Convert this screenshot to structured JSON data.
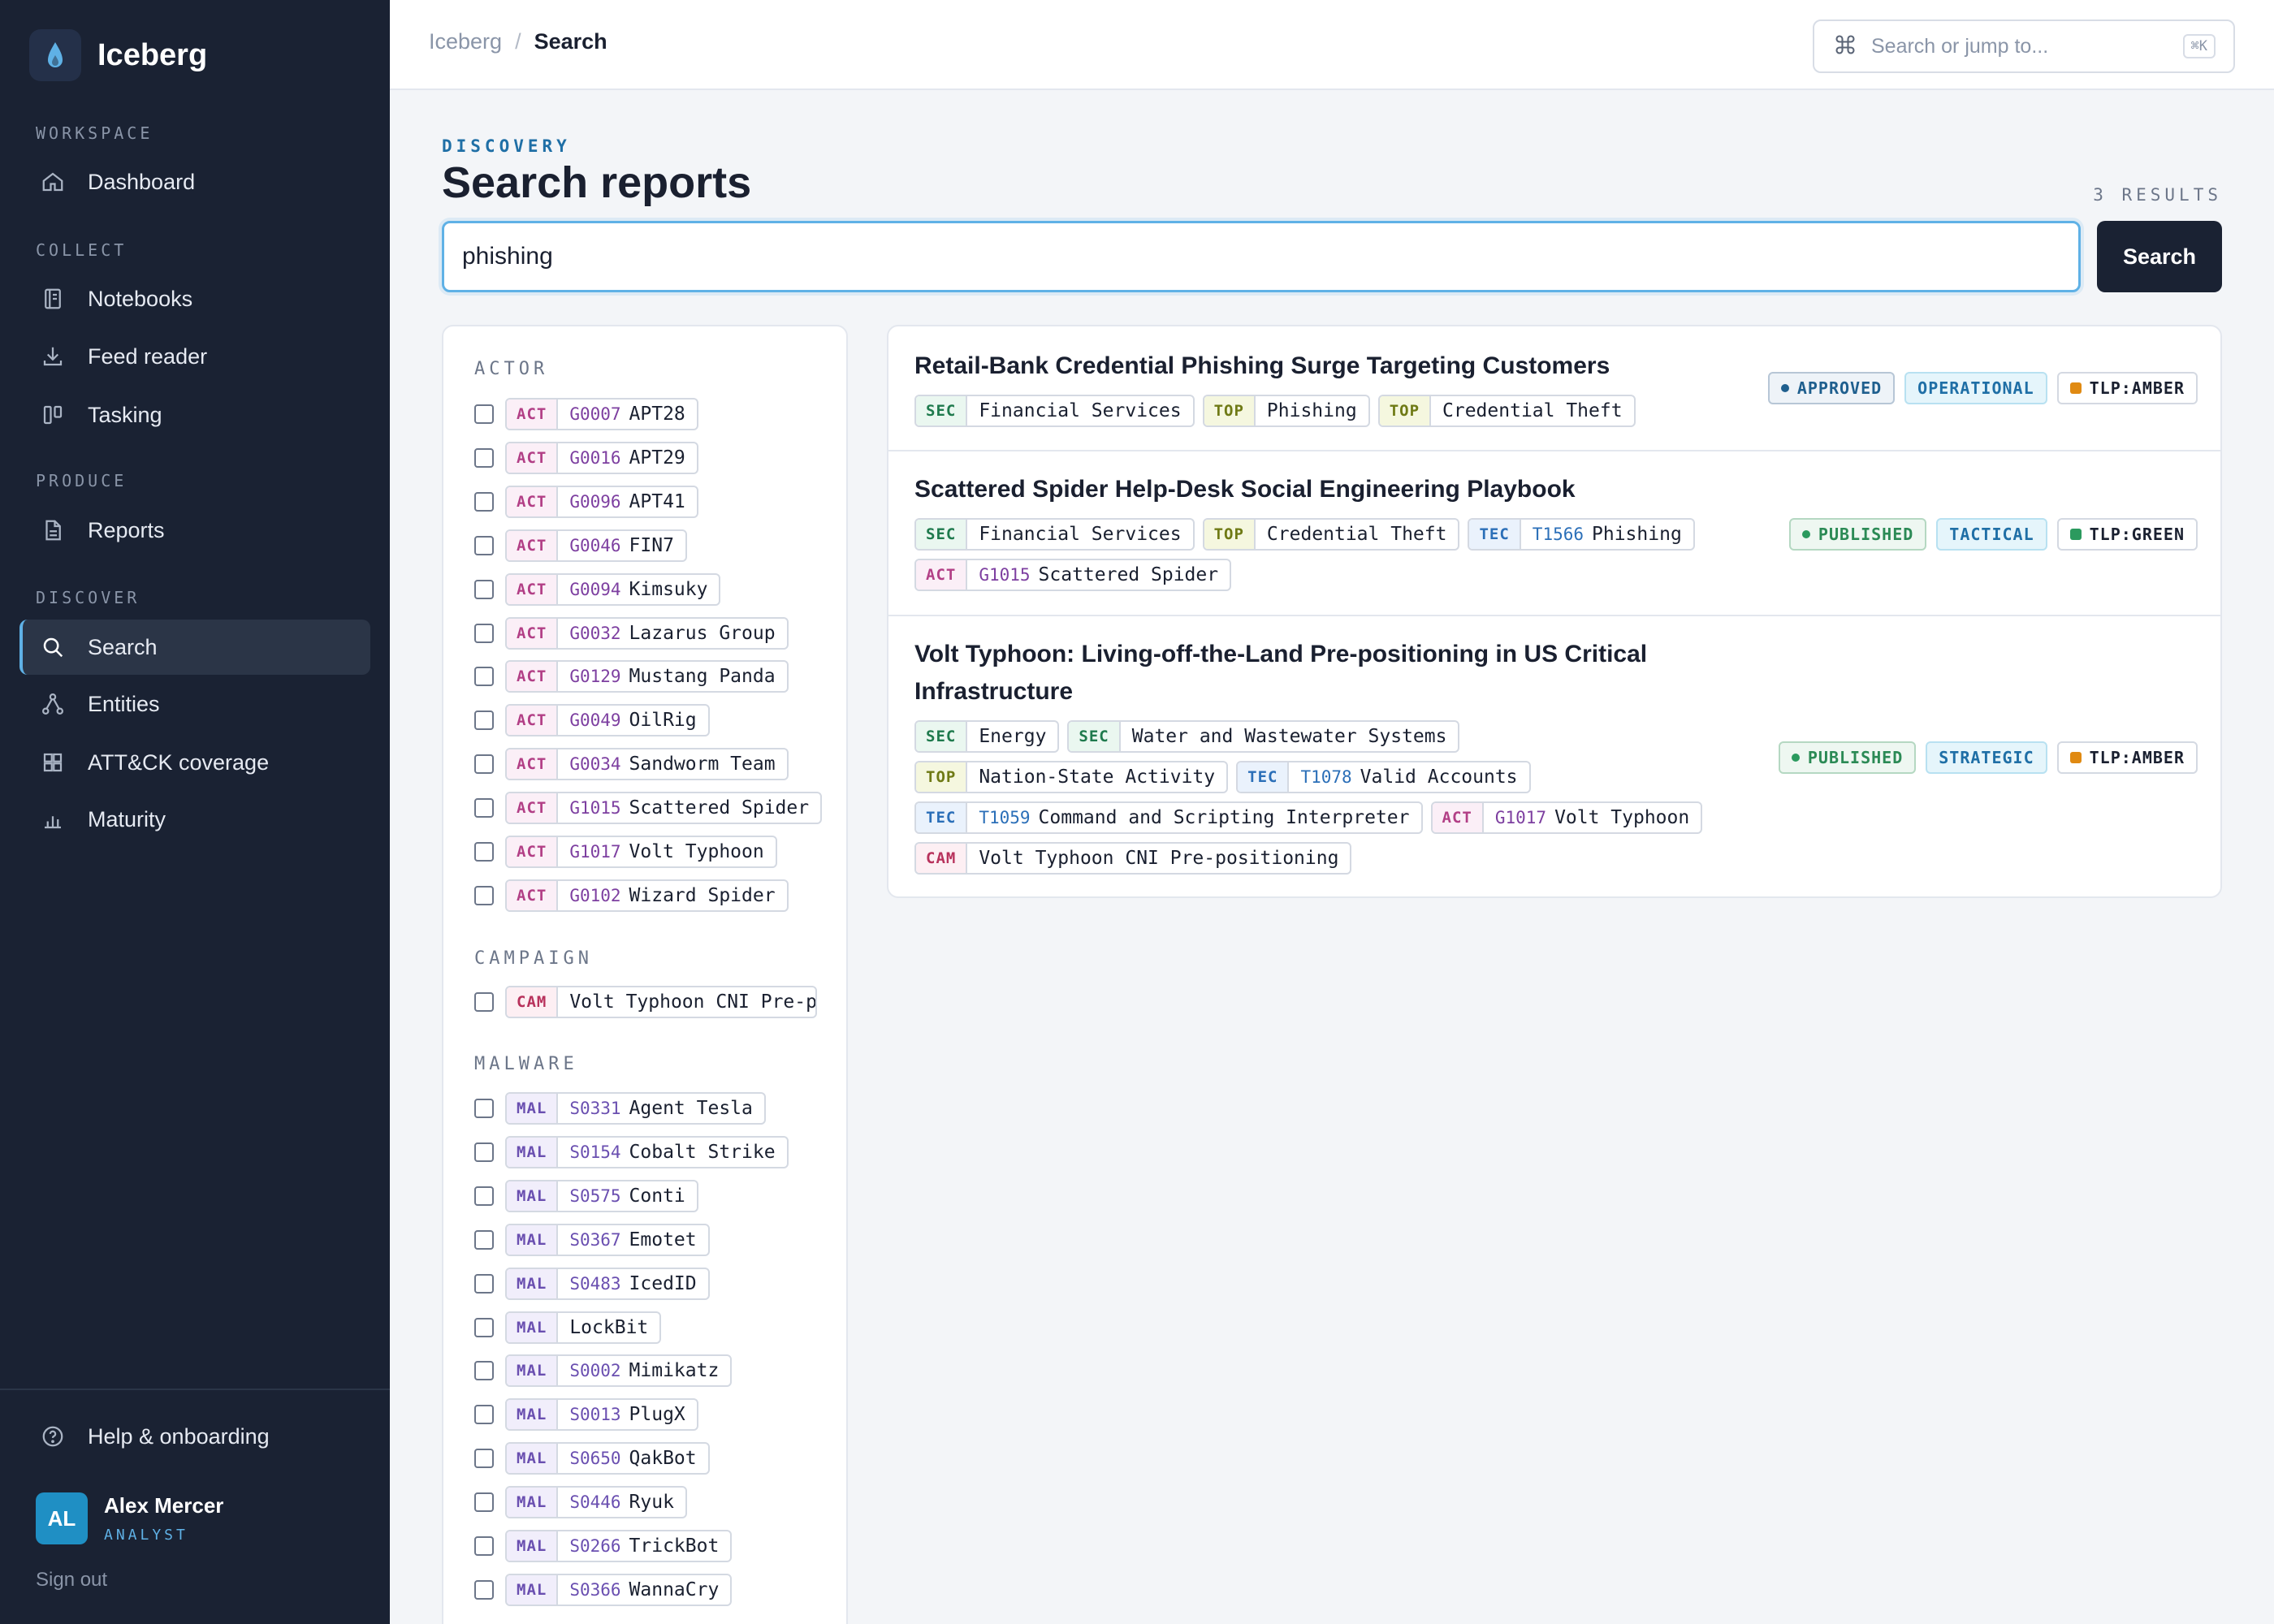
{
  "app": {
    "name": "Iceberg"
  },
  "sidebar": {
    "sections": [
      {
        "label": "WORKSPACE",
        "items": [
          {
            "label": "Dashboard",
            "icon": "home-icon"
          }
        ]
      },
      {
        "label": "COLLECT",
        "items": [
          {
            "label": "Notebooks",
            "icon": "notebook-icon"
          },
          {
            "label": "Feed reader",
            "icon": "download-icon"
          },
          {
            "label": "Tasking",
            "icon": "kanban-icon"
          }
        ]
      },
      {
        "label": "PRODUCE",
        "items": [
          {
            "label": "Reports",
            "icon": "document-icon"
          }
        ]
      },
      {
        "label": "DISCOVER",
        "items": [
          {
            "label": "Search",
            "icon": "search-icon",
            "active": true
          },
          {
            "label": "Entities",
            "icon": "graph-icon"
          },
          {
            "label": "ATT&CK coverage",
            "icon": "grid-icon"
          },
          {
            "label": "Maturity",
            "icon": "bar-chart-icon"
          }
        ]
      }
    ],
    "help_label": "Help & onboarding",
    "user": {
      "initials": "AL",
      "name": "Alex Mercer",
      "role": "ANALYST"
    },
    "signout_label": "Sign out"
  },
  "topbar": {
    "breadcrumb_root": "Iceberg",
    "breadcrumb_sep": "/",
    "breadcrumb_current": "Search",
    "jump_placeholder": "Search or jump to...",
    "jump_shortcut": "⌘K"
  },
  "main": {
    "eyebrow": "DISCOVERY",
    "title": "Search reports",
    "result_count": "3 RESULTS",
    "query": "phishing",
    "search_button": "Search"
  },
  "facets": {
    "actor": {
      "title": "ACTOR",
      "items": [
        {
          "type": "ACT",
          "code": "G0007",
          "name": "APT28"
        },
        {
          "type": "ACT",
          "code": "G0016",
          "name": "APT29"
        },
        {
          "type": "ACT",
          "code": "G0096",
          "name": "APT41"
        },
        {
          "type": "ACT",
          "code": "G0046",
          "name": "FIN7"
        },
        {
          "type": "ACT",
          "code": "G0094",
          "name": "Kimsuky"
        },
        {
          "type": "ACT",
          "code": "G0032",
          "name": "Lazarus Group"
        },
        {
          "type": "ACT",
          "code": "G0129",
          "name": "Mustang Panda"
        },
        {
          "type": "ACT",
          "code": "G0049",
          "name": "OilRig"
        },
        {
          "type": "ACT",
          "code": "G0034",
          "name": "Sandworm Team"
        },
        {
          "type": "ACT",
          "code": "G1015",
          "name": "Scattered Spider"
        },
        {
          "type": "ACT",
          "code": "G1017",
          "name": "Volt Typhoon"
        },
        {
          "type": "ACT",
          "code": "G0102",
          "name": "Wizard Spider"
        }
      ]
    },
    "campaign": {
      "title": "CAMPAIGN",
      "items": [
        {
          "type": "CAM",
          "code": "",
          "name": "Volt Typhoon CNI Pre-p"
        }
      ]
    },
    "malware": {
      "title": "MALWARE",
      "items": [
        {
          "type": "MAL",
          "code": "S0331",
          "name": "Agent Tesla"
        },
        {
          "type": "MAL",
          "code": "S0154",
          "name": "Cobalt Strike"
        },
        {
          "type": "MAL",
          "code": "S0575",
          "name": "Conti"
        },
        {
          "type": "MAL",
          "code": "S0367",
          "name": "Emotet"
        },
        {
          "type": "MAL",
          "code": "S0483",
          "name": "IcedID"
        },
        {
          "type": "MAL",
          "code": "",
          "name": "LockBit"
        },
        {
          "type": "MAL",
          "code": "S0002",
          "name": "Mimikatz"
        },
        {
          "type": "MAL",
          "code": "S0013",
          "name": "PlugX"
        },
        {
          "type": "MAL",
          "code": "S0650",
          "name": "QakBot"
        },
        {
          "type": "MAL",
          "code": "S0446",
          "name": "Ryuk"
        },
        {
          "type": "MAL",
          "code": "S0266",
          "name": "TrickBot"
        },
        {
          "type": "MAL",
          "code": "S0366",
          "name": "WannaCry"
        }
      ]
    }
  },
  "results": [
    {
      "title": "Retail-Bank Credential Phishing Surge Targeting Customers",
      "tag_lines": [
        [
          {
            "type": "SEC",
            "code": "",
            "name": "Financial Services"
          },
          {
            "type": "TOP",
            "code": "",
            "name": "Phishing"
          },
          {
            "type": "TOP",
            "code": "",
            "name": "Credential Theft"
          }
        ]
      ],
      "status": "APPROVED",
      "level": "OPERATIONAL",
      "tlp": "TLP:AMBER",
      "tlp_color": "#e08a12"
    },
    {
      "title": "Scattered Spider Help-Desk Social Engineering Playbook",
      "tag_lines": [
        [
          {
            "type": "SEC",
            "code": "",
            "name": "Financial Services"
          },
          {
            "type": "TOP",
            "code": "",
            "name": "Credential Theft"
          },
          {
            "type": "TEC",
            "code": "T1566",
            "name": "Phishing"
          }
        ],
        [
          {
            "type": "ACT",
            "code": "G1015",
            "name": "Scattered Spider"
          }
        ]
      ],
      "status": "PUBLISHED",
      "level": "TACTICAL",
      "tlp": "TLP:GREEN",
      "tlp_color": "#2b9a5e"
    },
    {
      "title": "Volt Typhoon: Living-off-the-Land Pre-positioning in US Critical Infrastructure",
      "tag_lines": [
        [
          {
            "type": "SEC",
            "code": "",
            "name": "Energy"
          },
          {
            "type": "SEC",
            "code": "",
            "name": "Water and Wastewater Systems"
          }
        ],
        [
          {
            "type": "TOP",
            "code": "",
            "name": "Nation-State Activity"
          },
          {
            "type": "TEC",
            "code": "T1078",
            "name": "Valid Accounts"
          }
        ],
        [
          {
            "type": "TEC",
            "code": "T1059",
            "name": "Command and Scripting Interpreter"
          },
          {
            "type": "ACT",
            "code": "G1017",
            "name": "Volt Typhoon"
          }
        ],
        [
          {
            "type": "CAM",
            "code": "",
            "name": "Volt Typhoon CNI Pre-positioning"
          }
        ]
      ],
      "status": "PUBLISHED",
      "level": "STRATEGIC",
      "tlp": "TLP:AMBER",
      "tlp_color": "#e08a12"
    }
  ]
}
